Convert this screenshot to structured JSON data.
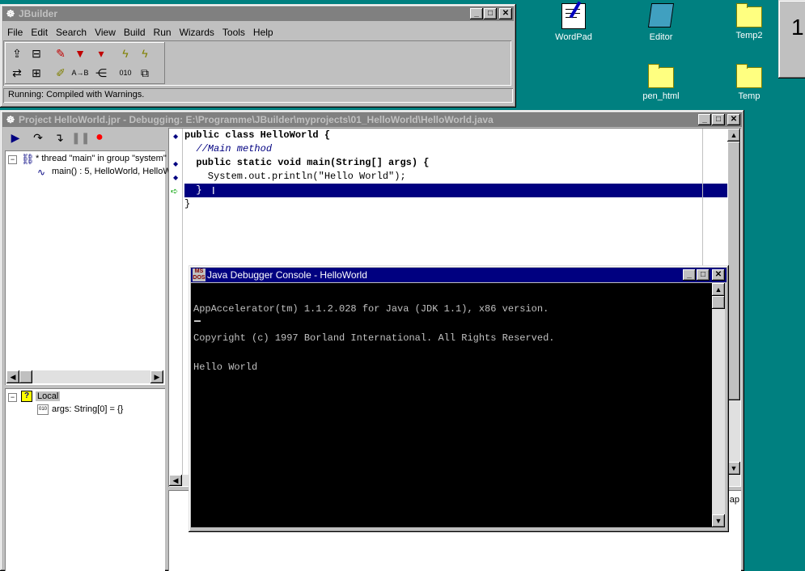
{
  "desktop": {
    "icons": [
      {
        "label": "WordPad"
      },
      {
        "label": "Editor"
      },
      {
        "label": "Temp2"
      },
      {
        "label": "pen_html"
      },
      {
        "label": "Temp"
      }
    ],
    "side_button_label": "1"
  },
  "jbuilder_main": {
    "title": "JBuilder",
    "menus": [
      "File",
      "Edit",
      "Search",
      "View",
      "Build",
      "Run",
      "Wizards",
      "Tools",
      "Help"
    ],
    "status": "Running:  Compiled with Warnings."
  },
  "project_window": {
    "title": "Project HelloWorld.jpr - Debugging:  E:\\Programme\\JBuilder\\myprojects\\01_HelloWorld\\HelloWorld.java",
    "thread_tree": {
      "thread": "* thread \"main\" in group \"system\"",
      "frame": "main() : 5, HelloWorld, HelloW"
    },
    "var_tree": {
      "root": "Local",
      "child": "args: String[0] = {}"
    },
    "code_lines": [
      "public class HelloWorld {",
      "  //Main method",
      "  public static void main(String[] args) {",
      "    System.out.println(\"Hello World\");",
      "  }",
      "}"
    ],
    "partial_text": "y ap"
  },
  "console_window": {
    "title": "Java Debugger Console - HelloWorld",
    "lines": [
      "AppAccelerator(tm) 1.1.2.028 for Java (JDK 1.1), x86 version.",
      "Copyright (c) 1997 Borland International. All Rights Reserved.",
      "Hello World"
    ]
  },
  "colors": {
    "desktop": "#008080",
    "title_active": "#000080",
    "title_inactive": "#808080",
    "selection": "#000080"
  }
}
